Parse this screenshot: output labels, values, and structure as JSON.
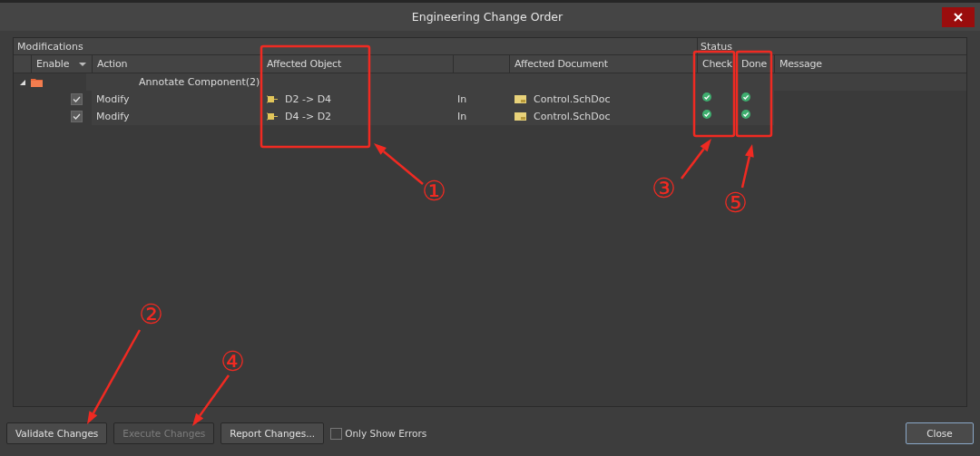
{
  "window": {
    "title": "Engineering Change Order"
  },
  "table": {
    "group_headers": [
      "Modifications",
      "Status"
    ],
    "columns": {
      "enable": "Enable",
      "action": "Action",
      "object": "Affected Object",
      "document": "Affected Document",
      "check": "Check",
      "done": "Done",
      "message": "Message"
    },
    "groups": [
      {
        "label": "Annotate Component(2)",
        "expanded": true,
        "children": [
          {
            "enabled": true,
            "action": "Modify",
            "object": "D2 -> D4",
            "direction": "In",
            "document": "Control.SchDoc",
            "check": true,
            "done": true
          },
          {
            "enabled": true,
            "action": "Modify",
            "object": "D4 -> D2",
            "direction": "In",
            "document": "Control.SchDoc",
            "check": true,
            "done": true
          }
        ]
      }
    ]
  },
  "buttons": [
    {
      "label": "Validate Changes",
      "disabled": false
    },
    {
      "label": "Execute Changes",
      "disabled": true
    },
    {
      "label": "Report Changes...",
      "disabled": false
    }
  ],
  "option": {
    "label": "Only Show Errors",
    "checked": false
  },
  "close_button": "Close",
  "annotations": [
    {
      "label": "①"
    },
    {
      "label": "②"
    },
    {
      "label": "③"
    },
    {
      "label": "④"
    },
    {
      "label": "⑤"
    }
  ]
}
